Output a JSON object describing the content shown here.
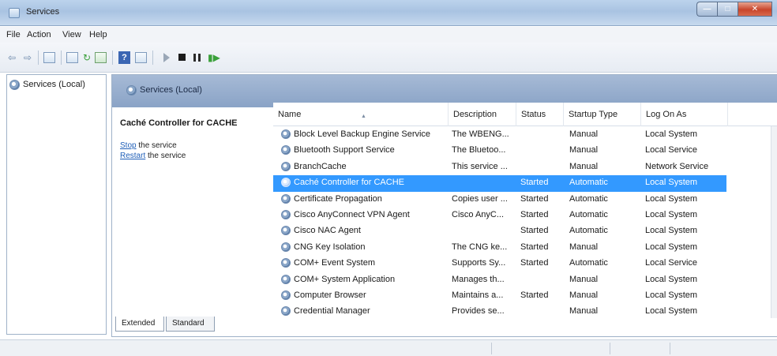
{
  "window": {
    "title": "Services",
    "minimize_glyph": "—",
    "maximize_glyph": "□",
    "close_glyph": "✕"
  },
  "menu": {
    "items": [
      "File",
      "Action",
      "View",
      "Help"
    ]
  },
  "toolbar": {
    "icons": [
      "back-arrow-icon",
      "forward-arrow-icon",
      "show-console-tree-icon",
      "properties-icon",
      "refresh-icon",
      "export-list-icon",
      "help-icon",
      "show-action-pane-icon",
      "start-service-icon",
      "stop-service-icon",
      "pause-service-icon",
      "restart-service-icon"
    ],
    "back_glyph": "⇦",
    "forward_glyph": "⇨",
    "help_glyph": "?",
    "restart_glyph": "▮▶"
  },
  "tree": {
    "root_label": "Services (Local)"
  },
  "panel": {
    "header_title": "Services (Local)",
    "selected_service": "Caché Controller for CACHE",
    "stop_link": "Stop",
    "stop_rest": " the service",
    "restart_link": "Restart",
    "restart_rest": " the service"
  },
  "table": {
    "columns": [
      "Name",
      "Description",
      "Status",
      "Startup Type",
      "Log On As"
    ],
    "rows": [
      {
        "name": "Block Level Backup Engine Service",
        "description": "The WBENG...",
        "status": "",
        "startup": "Manual",
        "logon": "Local System"
      },
      {
        "name": "Bluetooth Support Service",
        "description": "The Bluetoo...",
        "status": "",
        "startup": "Manual",
        "logon": "Local Service"
      },
      {
        "name": "BranchCache",
        "description": "This service ...",
        "status": "",
        "startup": "Manual",
        "logon": "Network Service"
      },
      {
        "name": "Caché Controller for CACHE",
        "description": "",
        "status": "Started",
        "startup": "Automatic",
        "logon": "Local System",
        "selected": true
      },
      {
        "name": "Certificate Propagation",
        "description": "Copies user ...",
        "status": "Started",
        "startup": "Automatic",
        "logon": "Local System"
      },
      {
        "name": "Cisco AnyConnect VPN Agent",
        "description": "Cisco AnyC...",
        "status": "Started",
        "startup": "Automatic",
        "logon": "Local System"
      },
      {
        "name": "Cisco NAC Agent",
        "description": "",
        "status": "Started",
        "startup": "Automatic",
        "logon": "Local System"
      },
      {
        "name": "CNG Key Isolation",
        "description": "The CNG ke...",
        "status": "Started",
        "startup": "Manual",
        "logon": "Local System"
      },
      {
        "name": "COM+ Event System",
        "description": "Supports Sy...",
        "status": "Started",
        "startup": "Automatic",
        "logon": "Local Service"
      },
      {
        "name": "COM+ System Application",
        "description": "Manages th...",
        "status": "",
        "startup": "Manual",
        "logon": "Local System"
      },
      {
        "name": "Computer Browser",
        "description": "Maintains a...",
        "status": "Started",
        "startup": "Manual",
        "logon": "Local System"
      },
      {
        "name": "Credential Manager",
        "description": "Provides se...",
        "status": "",
        "startup": "Manual",
        "logon": "Local System"
      }
    ]
  },
  "tabs": {
    "extended": "Extended",
    "standard": "Standard"
  },
  "colors": {
    "selection": "#3399ff",
    "link": "#1f5fb8",
    "header_bar": "#8aa3c6"
  }
}
